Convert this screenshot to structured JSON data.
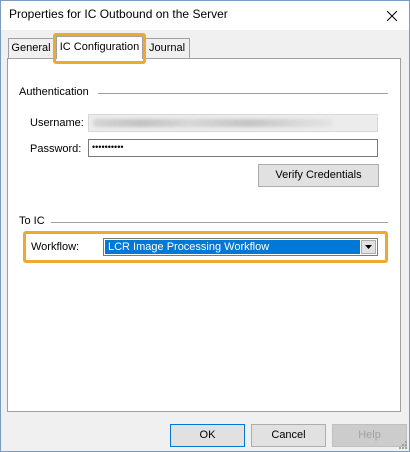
{
  "window": {
    "title": "Properties for IC Outbound on the Server"
  },
  "tabs": [
    {
      "label": "General"
    },
    {
      "label": "IC Configuration"
    },
    {
      "label": "Journal"
    }
  ],
  "authentication": {
    "group_label": "Authentication",
    "username_label": "Username:",
    "password_label": "Password:",
    "password_mask": "••••••••••",
    "verify_label": "Verify Credentials"
  },
  "to_ic": {
    "group_label": "To IC",
    "workflow_label": "Workflow:",
    "workflow_value": "LCR Image Processing Workflow"
  },
  "footer": {
    "ok_label": "OK",
    "cancel_label": "Cancel",
    "help_label": "Help"
  },
  "colors": {
    "highlight": "#f0a830",
    "selection": "#0078d7",
    "window_border": "#7a9cc0"
  },
  "icons": {
    "close": "close-icon",
    "dropdown": "chevron-down-icon",
    "grip": "resize-grip-icon"
  }
}
